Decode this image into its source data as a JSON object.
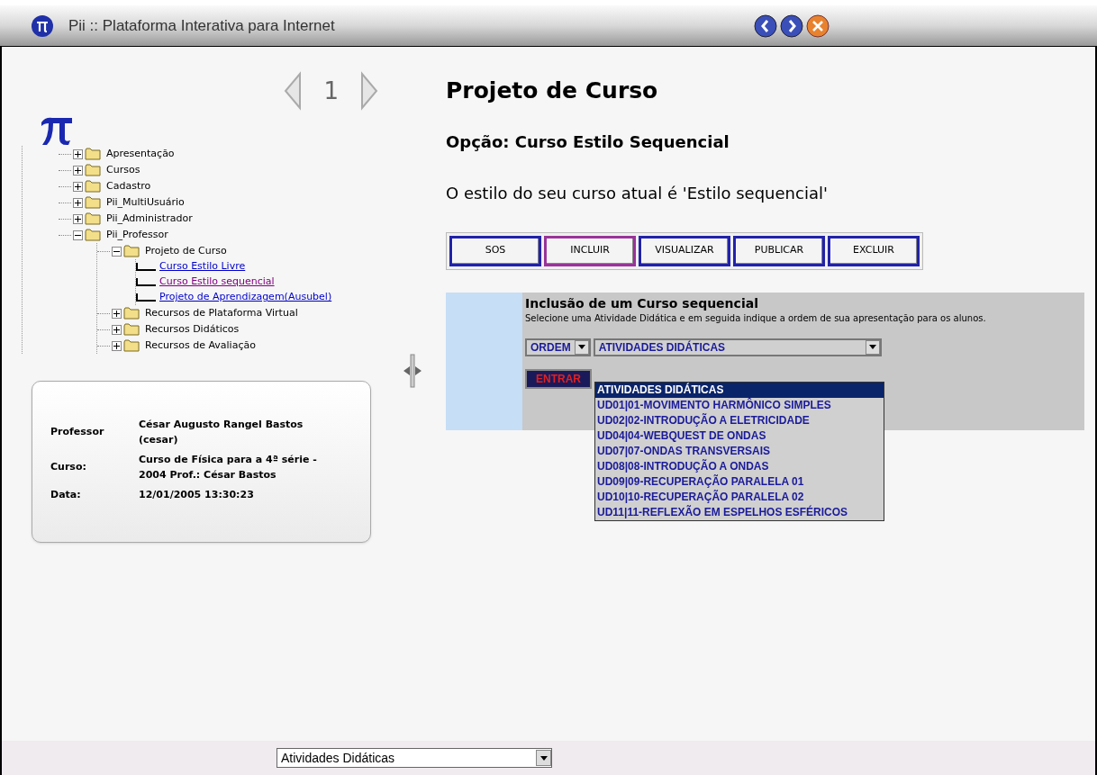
{
  "window": {
    "title": "Pii :: Plataforma Interativa para Internet"
  },
  "pager": {
    "page": "1"
  },
  "tree": [
    {
      "label": "Apresentação",
      "kind": "folder",
      "expanded": false
    },
    {
      "label": "Cursos",
      "kind": "folder",
      "expanded": false
    },
    {
      "label": "Cadastro",
      "kind": "folder",
      "expanded": false
    },
    {
      "label": "Pii_MultiUsuário",
      "kind": "folder",
      "expanded": false
    },
    {
      "label": "Pii_Administrador",
      "kind": "folder",
      "expanded": false
    },
    {
      "label": "Pii_Professor",
      "kind": "folder",
      "expanded": true,
      "children": [
        {
          "label": "Projeto de Curso",
          "kind": "folder",
          "expanded": true,
          "children": [
            {
              "label": "Curso Estilo Livre",
              "kind": "link",
              "selected": false
            },
            {
              "label": "Curso Estilo sequencial",
              "kind": "link",
              "selected": true
            },
            {
              "label": "Projeto de Aprendizagem(Ausubel)",
              "kind": "link",
              "selected": false
            }
          ]
        },
        {
          "label": "Recursos de Plataforma Virtual",
          "kind": "folder",
          "expanded": false
        },
        {
          "label": "Recursos Didáticos",
          "kind": "folder",
          "expanded": false
        },
        {
          "label": "Recursos de Avaliação",
          "kind": "folder",
          "expanded": false
        }
      ]
    }
  ],
  "info": [
    {
      "label": "Professor",
      "value": "César Augusto Rangel Bastos (cesar)"
    },
    {
      "label": "Curso:",
      "value": "Curso de Física para a 4ª série - 2004 Prof.: César Bastos"
    },
    {
      "label": "Data:",
      "value": "12/01/2005 13:30:23"
    }
  ],
  "heading": "Projeto de Curso",
  "option": "Opção: Curso Estilo Sequencial",
  "style_sentence": "O estilo do seu curso atual é 'Estilo sequencial'",
  "toolbar": [
    {
      "label": "SOS",
      "selected": false
    },
    {
      "label": "INCLUIR",
      "selected": true
    },
    {
      "label": "VISUALIZAR",
      "selected": false
    },
    {
      "label": "PUBLICAR",
      "selected": false
    },
    {
      "label": "EXCLUIR",
      "selected": false
    }
  ],
  "panel": {
    "title": "Inclusão de um Curso sequencial",
    "description": "Selecione uma Atividade Didática e em seguida indique a ordem de sua apresentação para os alunos.",
    "order_select": "ORDEM",
    "activity_select": "ATIVIDADES DIDÁTICAS",
    "enter_button": "ENTRAR",
    "options": [
      {
        "label": "ATIVIDADES DIDÁTICAS",
        "selected": true
      },
      {
        "label": "UD01|01-MOVIMENTO HARMÔNICO SIMPLES",
        "selected": false
      },
      {
        "label": "UD02|02-INTRODUÇÃO A ELETRICIDADE",
        "selected": false
      },
      {
        "label": "UD04|04-WEBQUEST DE ONDAS",
        "selected": false
      },
      {
        "label": "UD07|07-ONDAS TRANSVERSAIS",
        "selected": false
      },
      {
        "label": "UD08|08-INTRODUÇÃO A ONDAS",
        "selected": false
      },
      {
        "label": "UD09|09-RECUPERAÇÃO PARALELA 01",
        "selected": false
      },
      {
        "label": "UD10|10-RECUPERAÇÃO PARALELA 02",
        "selected": false
      },
      {
        "label": "UD11|11-REFLEXÃO EM ESPELHOS ESFÉRICOS",
        "selected": false
      }
    ]
  },
  "footer_select": "Atividades Didáticas"
}
